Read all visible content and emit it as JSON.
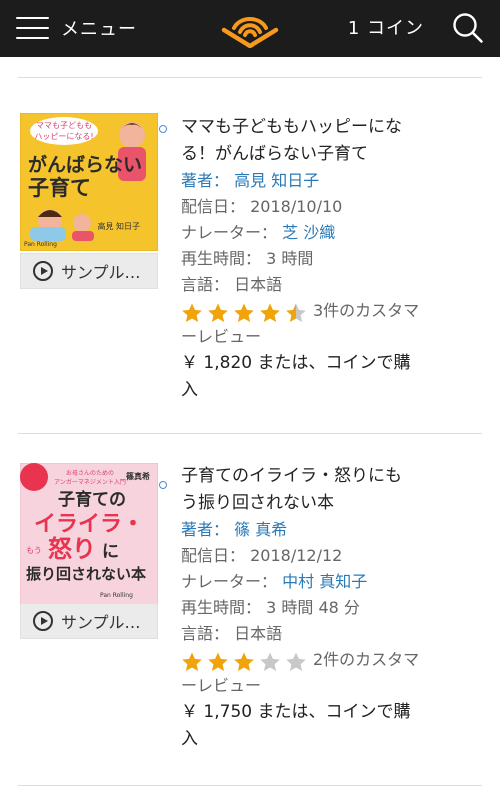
{
  "header": {
    "menu_label": "メニュー",
    "coins": "1 コイン"
  },
  "labels": {
    "sample": "サンプル…",
    "author": "著者：",
    "release": "配信日：",
    "narrator": "ナレーター：",
    "runtime": "再生時間：",
    "language": "言語："
  },
  "items": [
    {
      "title_line1": "ママも子どももハッピーにな",
      "title_line2": "る！がんばらない子育て",
      "author": "高見 知日子",
      "release": "2018/10/10",
      "narrator": "芝 沙織",
      "runtime": "3 時間",
      "language": "日本語",
      "rating": 4.5,
      "reviews_line1": "3件のカスタマ",
      "reviews_line2": "ーレビュー",
      "price_line1": "￥ 1,820 または、コインで購",
      "price_line2": "入",
      "cover": {
        "top_badge": "ママも子どもも ハッピーになる!",
        "title1": "がんばらない",
        "title2": "子育て",
        "author": "高見 知日子",
        "publisher": "Pan Rolling",
        "bg_color": "#f5c32c"
      }
    },
    {
      "title_line1": "子育てのイライラ・怒りにも",
      "title_line2": "う振り回されない本",
      "author": "篠 真希",
      "release": "2018/12/12",
      "narrator": "中村 真知子",
      "runtime": "3 時間 48 分",
      "language": "日本語",
      "rating": 3,
      "reviews_line1": "2件のカスタマ",
      "reviews_line2": "ーレビュー",
      "price_line1": "￥ 1,750 または、コインで購",
      "price_line2": "入",
      "cover": {
        "top_badge": "お母さんのための アンガーマネジメント入門",
        "author": "篠真希",
        "title1": "子育ての",
        "title2": "イライラ・",
        "title3": "怒り",
        "title3b": "に",
        "title4_prefix": "もう",
        "title4": "振り回されない本",
        "publisher": "Pan Rolling",
        "bg_color": "#f7d3de"
      }
    }
  ],
  "colors": {
    "header_bg": "#1c1c1c",
    "accent_orange": "#f7991c",
    "link_blue": "#2a7ab8",
    "star_on": "#f0a30a",
    "star_off": "#c8c8c8"
  }
}
